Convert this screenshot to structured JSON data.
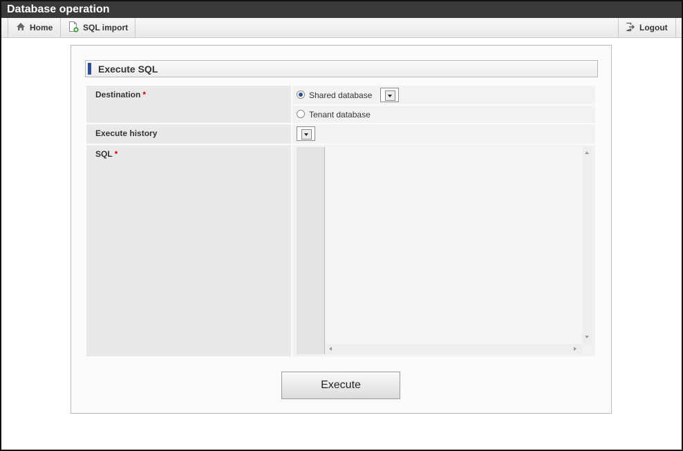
{
  "window": {
    "title": "Database operation"
  },
  "toolbar": {
    "home_label": "Home",
    "sql_import_label": "SQL import",
    "logout_label": "Logout"
  },
  "section": {
    "title": "Execute SQL"
  },
  "form": {
    "destination": {
      "label": "Destination",
      "required_mark": "*",
      "options": [
        {
          "label": "Shared database",
          "selected": true
        },
        {
          "label": "Tenant database",
          "selected": false
        }
      ]
    },
    "execute_history": {
      "label": "Execute history"
    },
    "sql": {
      "label": "SQL",
      "required_mark": "*",
      "value": ""
    }
  },
  "actions": {
    "execute_label": "Execute"
  },
  "icons": {
    "home": "home-icon",
    "sql_import": "document-add-icon",
    "logout": "logout-icon"
  },
  "colors": {
    "title_bar": "#3a3a3a",
    "accent": "#2f4f9a",
    "required": "#cc0000"
  }
}
